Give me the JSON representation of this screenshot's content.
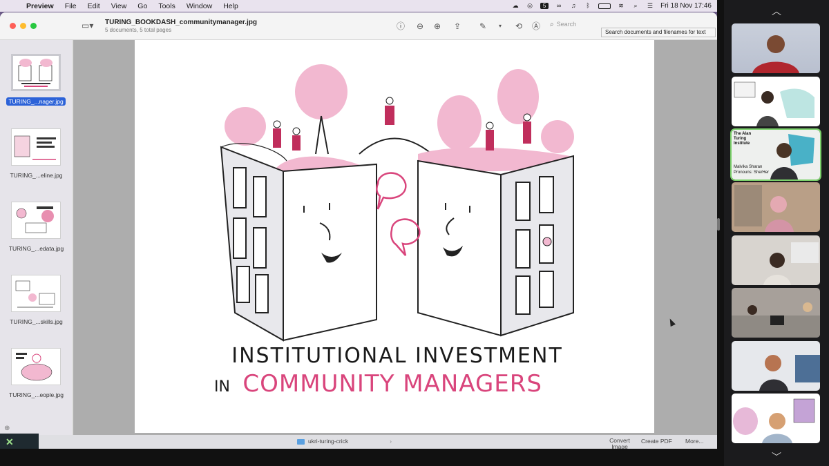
{
  "menubar": {
    "app_name": "Preview",
    "items": [
      "File",
      "Edit",
      "View",
      "Go",
      "Tools",
      "Window",
      "Help"
    ],
    "clock": "Fri 18 Nov  17:46",
    "status_icons": [
      "cloud-icon",
      "creative-cloud-icon",
      "badge-5-icon",
      "link-icon",
      "headphones-icon",
      "bluetooth-icon",
      "battery-icon",
      "wifi-icon",
      "search-icon",
      "control-center-icon"
    ]
  },
  "window": {
    "title": "TURING_BOOKDASH_communitymanager.jpg",
    "subtitle": "5 documents, 5 total pages",
    "search_placeholder": "Search",
    "tooltip": "Search documents and filenames for text",
    "toolbar_icons": [
      "info-icon",
      "zoom-out-icon",
      "zoom-in-icon",
      "share-icon",
      "markup-icon",
      "rotate-icon",
      "highlight-icon"
    ]
  },
  "sidebar": {
    "items": [
      {
        "label": "TURING_...nager.jpg",
        "selected": true
      },
      {
        "label": "TURING_...eline.jpg",
        "selected": false
      },
      {
        "label": "TURING_...edata.jpg",
        "selected": false
      },
      {
        "label": "TURING_...skills.jpg",
        "selected": false
      },
      {
        "label": "TURING_...eople.jpg",
        "selected": false
      }
    ]
  },
  "illustration": {
    "line1": "INSTITUTIONAL INVESTMENT",
    "line2_prefix": "IN",
    "line2_emph": "COMMUNITY MANAGERS",
    "colors": {
      "pink": "#d9457c",
      "light_pink": "#f2b8d0",
      "ink": "#1a1a1a"
    }
  },
  "finder": {
    "folder": "ukri-turing-crick",
    "actions": [
      "Convert Image",
      "Create PDF",
      "More..."
    ]
  },
  "participants": {
    "tiles": [
      {
        "name": "",
        "active": false
      },
      {
        "name": "",
        "active": false
      },
      {
        "name": "Malvika Sharan",
        "active": true,
        "org": "The Alan Turing Institute",
        "pronouns": "Pronouns: She/Her"
      },
      {
        "name": "",
        "active": false
      },
      {
        "name": "",
        "active": false
      },
      {
        "name": "",
        "active": false
      },
      {
        "name": "",
        "active": false
      },
      {
        "name": "",
        "active": false
      }
    ]
  }
}
